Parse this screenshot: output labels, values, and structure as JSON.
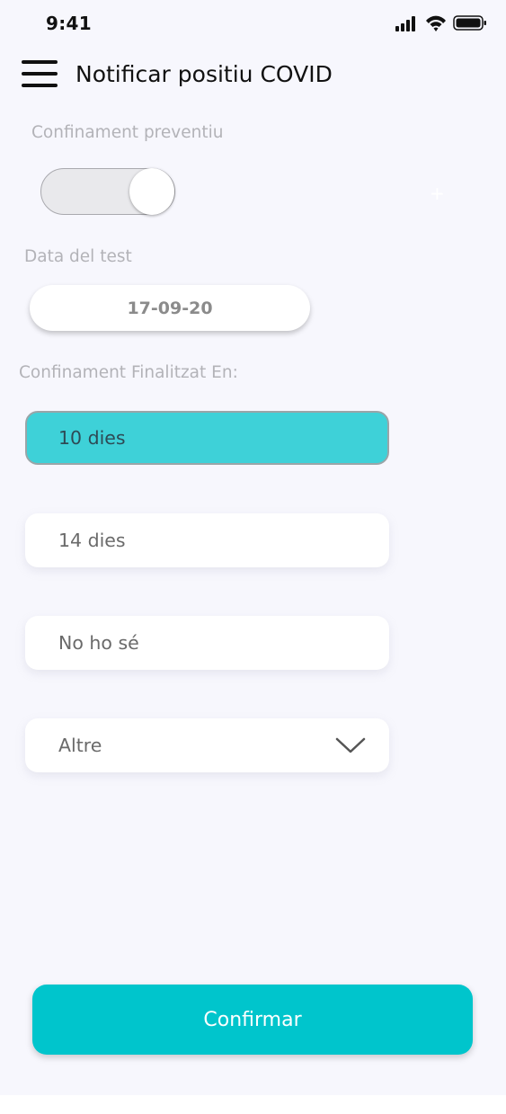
{
  "status_bar": {
    "time": "9:41",
    "icons": [
      "cellular-signal-icon",
      "wifi-icon",
      "battery-icon"
    ]
  },
  "header": {
    "menu_icon": "hamburger-menu-icon",
    "title": "Notificar positiu COVID"
  },
  "preventive_confinement": {
    "label": "Confinament preventiu",
    "toggle_on": true
  },
  "test_date": {
    "label": "Data del test",
    "value": "17-09-20"
  },
  "confinement_end": {
    "label": "Confinament Finalitzat En:",
    "options": [
      {
        "label": "10 dies",
        "selected": true
      },
      {
        "label": "14 dies",
        "selected": false
      },
      {
        "label": "No ho sé",
        "selected": false
      },
      {
        "label": "Altre",
        "selected": false,
        "icon": "chevron-down-icon"
      }
    ]
  },
  "confirm_button": {
    "label": "Confirmar"
  },
  "colors": {
    "accent": "#00c5cc",
    "selected_option": "#3ed1d8",
    "background": "#f7f7fd",
    "muted_text": "#b3b3b8"
  }
}
